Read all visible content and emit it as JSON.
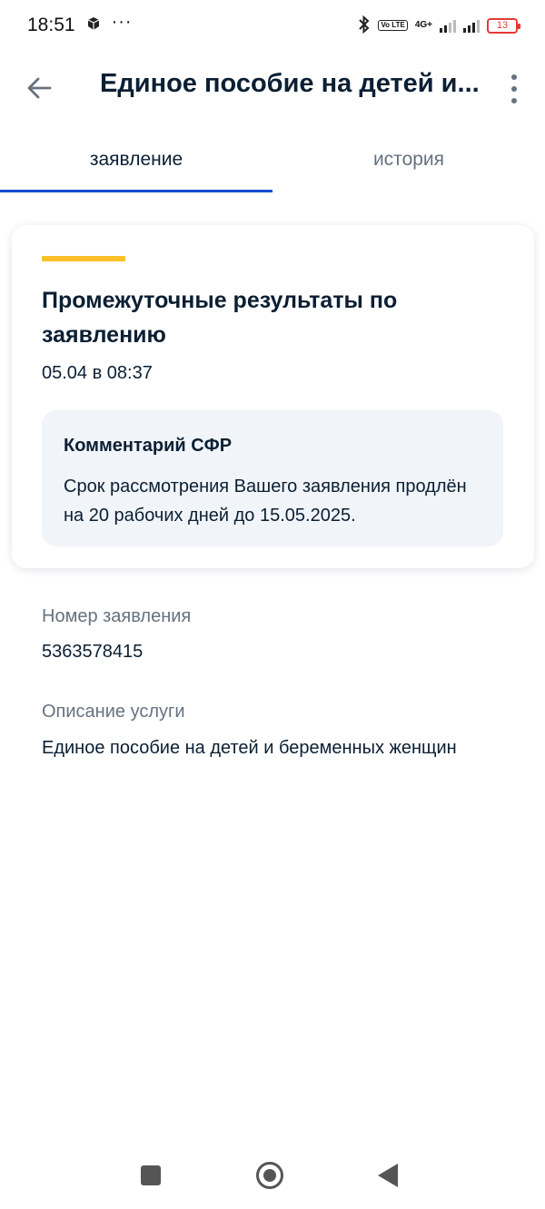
{
  "status_bar": {
    "time": "18:51",
    "overflow": "···",
    "battery": "13",
    "network": "4G+",
    "volte": "Vo LTE"
  },
  "header": {
    "title": "Единое пособие на детей и...",
    "back_icon": "arrow-left-icon",
    "menu_icon": "more-vertical-icon"
  },
  "tabs": [
    {
      "label": "заявление",
      "active": true
    },
    {
      "label": "история",
      "active": false
    }
  ],
  "card": {
    "title": "Промежуточные результаты по заявлению",
    "date": "05.04 в 08:37",
    "accent_color": "#fcc02b",
    "comment": {
      "title": "Комментарий СФР",
      "text": "Срок рассмотрения Вашего заявления продлён на 20 рабочих дней до 15.05.2025."
    }
  },
  "details": {
    "application_number_label": "Номер заявления",
    "application_number": "5363578415",
    "service_description_label": "Описание услуги",
    "service_description": "Единое пособие на детей и беременных женщин"
  },
  "colors": {
    "primary": "#0d4cd3",
    "text": "#0b1f33",
    "secondary_text": "#66727f",
    "comment_bg": "#f1f4f9"
  }
}
